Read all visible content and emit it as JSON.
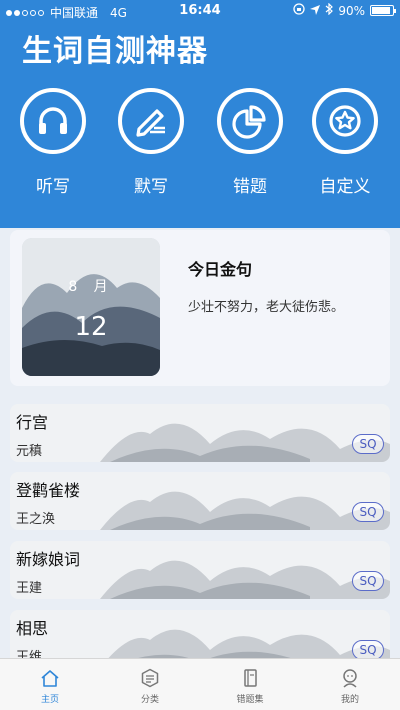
{
  "status_bar": {
    "carrier": "中国联通",
    "network": "4G",
    "time": "16:44",
    "battery_percent": "90%",
    "battery_level": 0.9
  },
  "app_title": "生词自测神器",
  "features": [
    {
      "label": "听写",
      "icon": "headphones-icon"
    },
    {
      "label": "默写",
      "icon": "pen-write-icon"
    },
    {
      "label": "错题",
      "icon": "pie-chart-icon"
    },
    {
      "label": "自定义",
      "icon": "star-icon"
    }
  ],
  "daily": {
    "month": "8 月",
    "day": "12",
    "title": "今日金句",
    "quote": "少壮不努力，老大徒伤悲。"
  },
  "poems": [
    {
      "title": "行宫",
      "author": "元稹",
      "badge": "SQ"
    },
    {
      "title": "登鹳雀楼",
      "author": "王之涣",
      "badge": "SQ"
    },
    {
      "title": "新嫁娘词",
      "author": "王建",
      "badge": "SQ"
    },
    {
      "title": "相思",
      "author": "王维",
      "badge": "SQ"
    }
  ],
  "tabs": [
    {
      "label": "主页",
      "active": true
    },
    {
      "label": "分类",
      "active": false
    },
    {
      "label": "错题集",
      "active": false
    },
    {
      "label": "我的",
      "active": false
    }
  ],
  "colors": {
    "primary": "#2f86d8",
    "badge": "#4b5dc0"
  }
}
